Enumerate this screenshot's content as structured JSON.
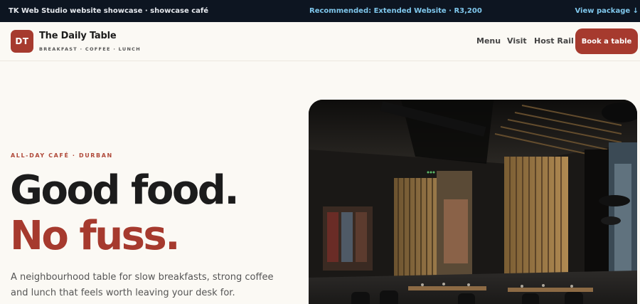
{
  "topbar": {
    "left": "TK Web Studio website showcase · showcase café",
    "center": "Recommended: Extended Website · R3,200",
    "right": "View package ↓"
  },
  "brand": {
    "initials": "DT",
    "name": "The Daily Table",
    "tagline": "BREAKFAST · COFFEE · LUNCH"
  },
  "nav": {
    "items": [
      {
        "label": "Menu"
      },
      {
        "label": "Visit"
      },
      {
        "label": "Host Rail"
      }
    ],
    "cta": "Book a table"
  },
  "hero": {
    "eyebrow": "ALL-DAY CAFÉ · DURBAN",
    "headline_1": "Good food.",
    "headline_2": "No fuss.",
    "lead": "A neighbourhood table for slow breakfasts, strong coffee and lunch that feels worth leaving your desk for."
  },
  "colors": {
    "accent": "#a63a2e",
    "topbar_bg": "#0d1521",
    "topbar_link": "#7fc7ec",
    "page_bg": "#fbf9f4"
  }
}
